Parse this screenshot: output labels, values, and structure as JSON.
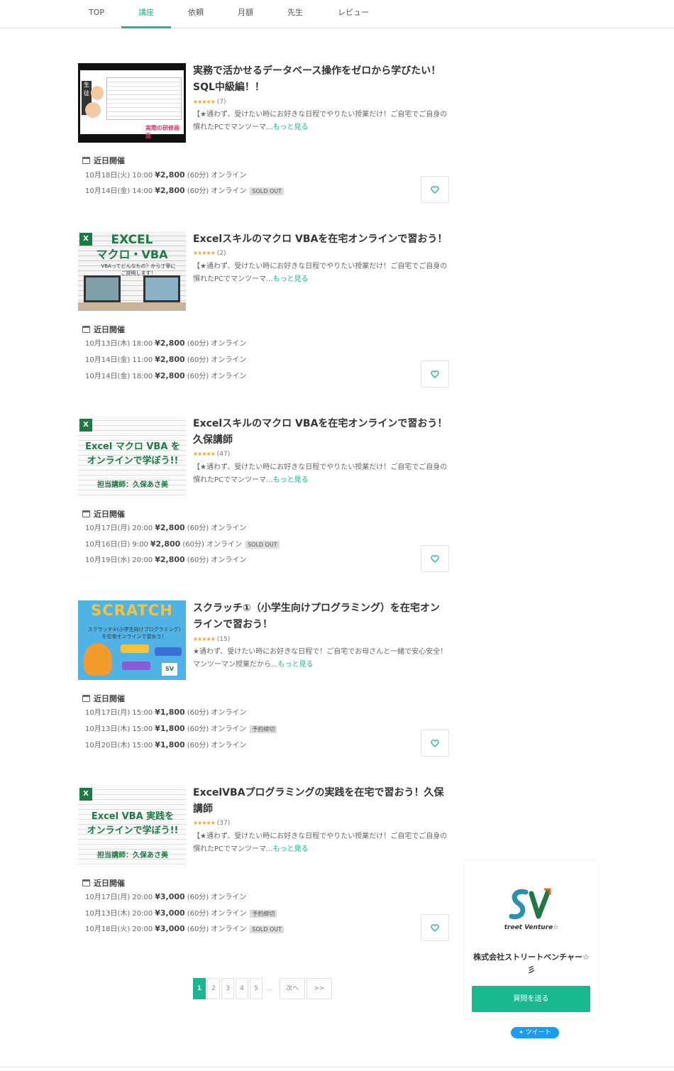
{
  "nav": {
    "tabs": [
      {
        "label": "TOP"
      },
      {
        "label": "講座"
      },
      {
        "label": "依頼"
      },
      {
        "label": "月額"
      },
      {
        "label": "先生"
      },
      {
        "label": "レビュー"
      }
    ],
    "active_index": 1
  },
  "colors": {
    "accent": "#19b88f",
    "star": "#f5a623",
    "tweet": "#1d9bf0"
  },
  "upcoming_label": "近日開催",
  "more_label": "もっと見る",
  "courses": [
    {
      "title": "実務で活かせるデータベース操作をゼロから学びたい！SQL中級編！！",
      "stars": "★★★★★",
      "rating_count": "(7)",
      "desc": "【★通わず、受けたい時にお好きな日程でやりたい授業だけ！ご自宅でご自身の慣れたPCでマンツーマ...",
      "thumb_caption": "実際の研修画面",
      "sessions": [
        {
          "date": "10月18日(火) 10:00",
          "price": "¥2,800",
          "duration": "(60分)",
          "mode": "オンライン",
          "badge": ""
        },
        {
          "date": "10月14日(金) 14:00",
          "price": "¥2,800",
          "duration": "(60分)",
          "mode": "オンライン",
          "badge": "SOLD OUT"
        }
      ]
    },
    {
      "title": "Excelスキルのマクロ VBAを在宅オンラインで習おう！",
      "stars": "★★★★★",
      "rating_count": "(2)",
      "desc": "【★通わず、受けたい時にお好きな日程でやりたい授業だけ！ご自宅でご自身の慣れたPCでマンツーマ...",
      "thumb_title1": "EXCEL",
      "thumb_title2": "マクロ・VBA",
      "thumb_sub": "VBAってどんなもの？から丁寧にご説明します！",
      "sessions": [
        {
          "date": "10月13日(木) 18:00",
          "price": "¥2,800",
          "duration": "(60分)",
          "mode": "オンライン",
          "badge": ""
        },
        {
          "date": "10月14日(金) 11:00",
          "price": "¥2,800",
          "duration": "(60分)",
          "mode": "オンライン",
          "badge": ""
        },
        {
          "date": "10月14日(金) 18:00",
          "price": "¥2,800",
          "duration": "(60分)",
          "mode": "オンライン",
          "badge": ""
        }
      ]
    },
    {
      "title": "Excelスキルのマクロ VBAを在宅オンラインで習おう！久保講師",
      "stars": "★★★★★",
      "rating_count": "(47)",
      "desc": "【★通わず、受けたい時にお好きな日程でやりたい授業だけ！ご自宅でご自身の慣れたPCでマンツーマ...",
      "thumb_title1": "Excel マクロ VBA を",
      "thumb_title2": "オンラインで学ぼう!!",
      "thumb_sub": "担当講師：久保あさ美",
      "sessions": [
        {
          "date": "10月17日(月) 20:00",
          "price": "¥2,800",
          "duration": "(60分)",
          "mode": "オンライン",
          "badge": ""
        },
        {
          "date": "10月16日(日) 9:00",
          "price": "¥2,800",
          "duration": "(60分)",
          "mode": "オンライン",
          "badge": "SOLD OUT"
        },
        {
          "date": "10月19日(水) 20:00",
          "price": "¥2,800",
          "duration": "(60分)",
          "mode": "オンライン",
          "badge": ""
        }
      ]
    },
    {
      "title": "スクラッチ①（小学生向けプログラミング）を在宅オンラインで習おう！",
      "stars": "★★★★★",
      "rating_count": "(15)",
      "desc": "★通わず、受けたい時にお好きな日程で！ご自宅でお母さんと一緒で安心安全！マンツーマン授業だから...",
      "thumb_title1": "SCRATCH",
      "thumb_sub": "スクラッチ①(小学生向けプログラミング)を在宅オンラインで習おう！",
      "sessions": [
        {
          "date": "10月17日(月) 15:00",
          "price": "¥1,800",
          "duration": "(60分)",
          "mode": "オンライン",
          "badge": ""
        },
        {
          "date": "10月13日(木) 15:00",
          "price": "¥1,800",
          "duration": "(60分)",
          "mode": "オンライン",
          "badge": "予約締切"
        },
        {
          "date": "10月20日(木) 15:00",
          "price": "¥1,800",
          "duration": "(60分)",
          "mode": "オンライン",
          "badge": ""
        }
      ]
    },
    {
      "title": "ExcelVBAプログラミングの実践を在宅で習おう！久保講師",
      "stars": "★★★★★",
      "rating_count": "(37)",
      "desc": "【★通わず、受けたい時にお好きな日程でやりたい授業だけ！ご自宅でご自身の慣れたPCでマンツーマ...",
      "thumb_title1": "Excel VBA 実践を",
      "thumb_title2": "オンラインで学ぼう!!",
      "thumb_sub": "担当講師：久保あさ美",
      "sessions": [
        {
          "date": "10月17日(月) 20:00",
          "price": "¥3,000",
          "duration": "(60分)",
          "mode": "オンライン",
          "badge": ""
        },
        {
          "date": "10月13日(木) 20:00",
          "price": "¥3,000",
          "duration": "(60分)",
          "mode": "オンライン",
          "badge": "予約締切"
        },
        {
          "date": "10月18日(火) 20:00",
          "price": "¥3,000",
          "duration": "(60分)",
          "mode": "オンライン",
          "badge": "SOLD OUT"
        }
      ]
    }
  ],
  "pagination": {
    "pages": [
      "1",
      "2",
      "3",
      "4",
      "5"
    ],
    "ellipsis": "...",
    "next_label": "次へ",
    "last_label": ">>",
    "current": "1"
  },
  "company": {
    "logo_text": "treet Venture☆",
    "logo_mark": "SV",
    "name": "株式会社ストリートベンチャー☆彡",
    "ask_label": "質問を送る"
  },
  "tweet_label": "ツイート"
}
